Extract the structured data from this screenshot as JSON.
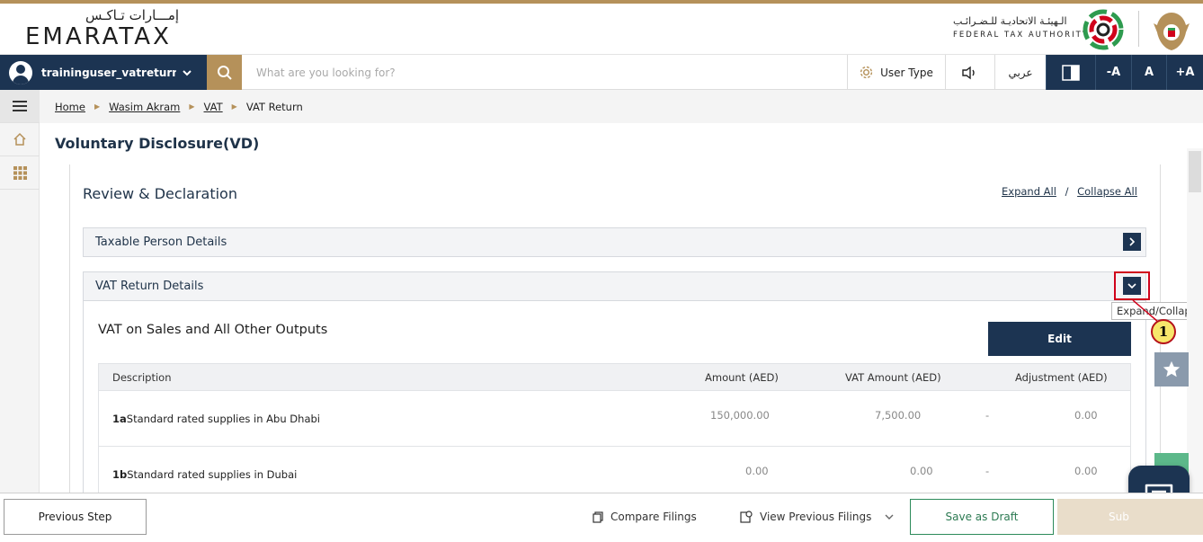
{
  "header": {
    "logo_ar": "إمـــارات تـاكـس",
    "logo_en": "EMARATAX",
    "fta_ar": "الـهيئـة الاتحاديـة للـضـرائـب",
    "fta_en": "FEDERAL TAX AUTHORITY"
  },
  "toolbar": {
    "user_name": "traininguser_vatreturns...",
    "search_placeholder": "What are you looking for?",
    "user_type_label": "User Type",
    "arabic_label": "عربي",
    "font_decrease": "-A",
    "font_normal": "A",
    "font_increase": "+A"
  },
  "breadcrumb": {
    "items": [
      "Home",
      "Wasim Akram",
      "VAT"
    ],
    "current": "VAT Return"
  },
  "page_title": "Voluntary Disclosure(VD)",
  "review": {
    "title": "Review & Declaration",
    "expand_all": "Expand All",
    "separator": "/",
    "collapse_all": "Collapse All"
  },
  "accordions": {
    "taxable_person": "Taxable Person Details",
    "vat_return": "VAT Return Details"
  },
  "tooltip": "Expand/Collapse",
  "callout_number": "1",
  "sales": {
    "title": "VAT on Sales and All Other Outputs",
    "edit_label": "Edit",
    "columns": {
      "description": "Description",
      "amount": "Amount (AED)",
      "vat_amount": "VAT Amount (AED)",
      "adjustment": "Adjustment (AED)"
    },
    "rows": [
      {
        "code": "1a",
        "description": "Standard rated supplies in Abu Dhabi",
        "amount": "150,000.00",
        "vat_amount": "7,500.00",
        "dash": "-",
        "adjustment": "0.00"
      },
      {
        "code": "1b",
        "description": "Standard rated supplies in Dubai",
        "amount": "0.00",
        "vat_amount": "0.00",
        "dash": "-",
        "adjustment": "0.00"
      }
    ]
  },
  "footer": {
    "previous_step": "Previous Step",
    "compare_filings": "Compare Filings",
    "view_previous_filings": "View Previous Filings",
    "save_as_draft": "Save as Draft",
    "submit": "Sub"
  },
  "colors": {
    "primary": "#1c3452",
    "accent_gold": "#b5915a",
    "draft_green": "#2c8a5a",
    "highlight_red": "#d0021b"
  }
}
